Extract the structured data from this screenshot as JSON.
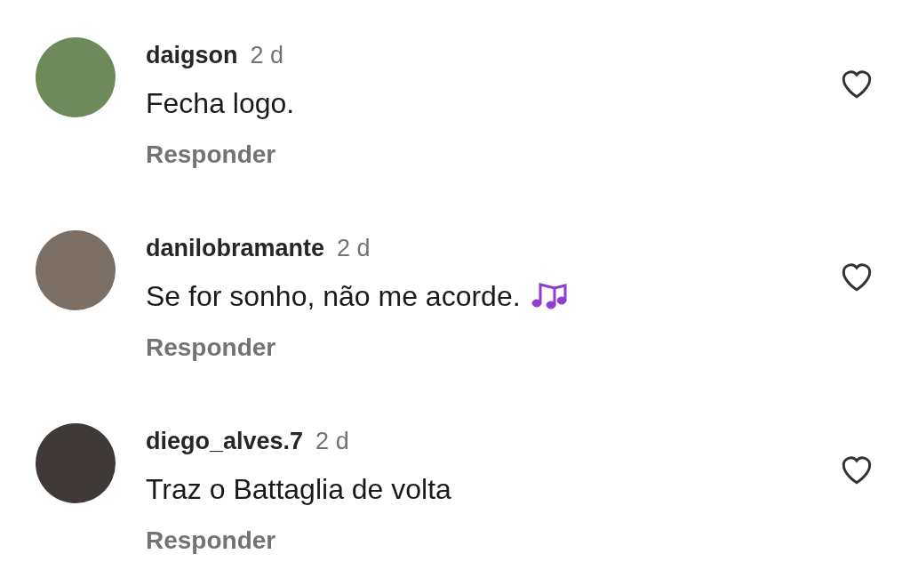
{
  "comments": [
    {
      "username": "daigson",
      "time": "2 d",
      "text": "Fecha logo.",
      "music_emoji": false,
      "reply": "Responder",
      "liked": false
    },
    {
      "username": "danilobramante",
      "time": "2 d",
      "text": "Se for sonho, não me acorde.",
      "music_emoji": true,
      "reply": "Responder",
      "liked": false
    },
    {
      "username": "diego_alves.7",
      "time": "2 d",
      "text": "Traz o Battaglia de volta",
      "music_emoji": false,
      "reply": "Responder",
      "liked": false
    }
  ]
}
